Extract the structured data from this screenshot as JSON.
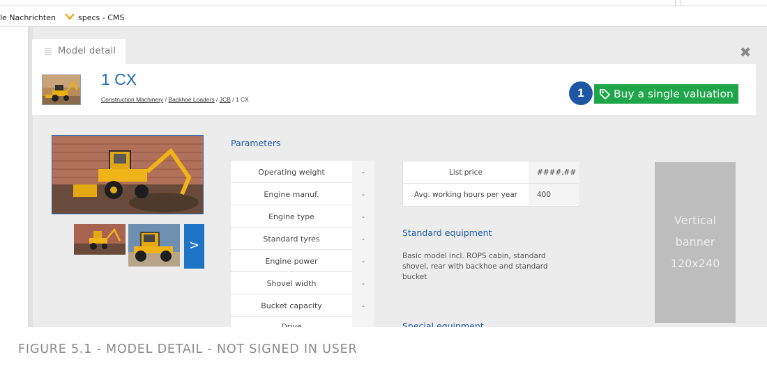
{
  "bookmarks": {
    "item1": "le Nachrichten",
    "item2": "specs - CMS",
    "chevron_icon": "chevron-down-icon",
    "chevron_color": "#f0a020"
  },
  "modal": {
    "tab_label": "Model detail",
    "tab_icon": "document-lines-icon",
    "close_icon": "close-icon",
    "close_glyph": "✖"
  },
  "header": {
    "title": "1 CX",
    "breadcrumb": {
      "items": [
        "Construction Machinery",
        "Backhoe Loaders",
        "JCB"
      ],
      "separator": "/",
      "current": "1 CX"
    },
    "step_badge": "1",
    "buy_button_label": "Buy a single valuation",
    "buy_button_icon": "tag-icon",
    "buy_button_color": "#1fa64a",
    "badge_color": "#1d57a3"
  },
  "gallery": {
    "next_label": ">",
    "next_color": "#1e74c4"
  },
  "parameters": {
    "title": "Parameters",
    "rows": [
      {
        "label": "Operating weight",
        "value": "-"
      },
      {
        "label": "Engine manuf.",
        "value": "-"
      },
      {
        "label": "Engine type",
        "value": "-"
      },
      {
        "label": "Standard tyres",
        "value": "-"
      },
      {
        "label": "Engine power",
        "value": "-"
      },
      {
        "label": "Shovel width",
        "value": "-"
      },
      {
        "label": "Bucket capacity",
        "value": "-"
      },
      {
        "label": "Drive",
        "value": "-"
      }
    ]
  },
  "pricing": {
    "rows": [
      {
        "label": "List price",
        "value": "####,##"
      },
      {
        "label": "Avg. working hours per year",
        "value": "400"
      }
    ]
  },
  "standard_equipment": {
    "title": "Standard equipment",
    "text": "Basic model incl. ROPS cabin, standard shovel, rear with backhoe and standard bucket"
  },
  "special_equipment": {
    "title": "Special equipment"
  },
  "banner": {
    "line1": "Vertical",
    "line2": "banner",
    "line3": "120x240"
  },
  "caption": "FIGURE 5.1 - MODEL DETAIL - NOT SIGNED IN USER",
  "accent_color": "#1f6ab5"
}
